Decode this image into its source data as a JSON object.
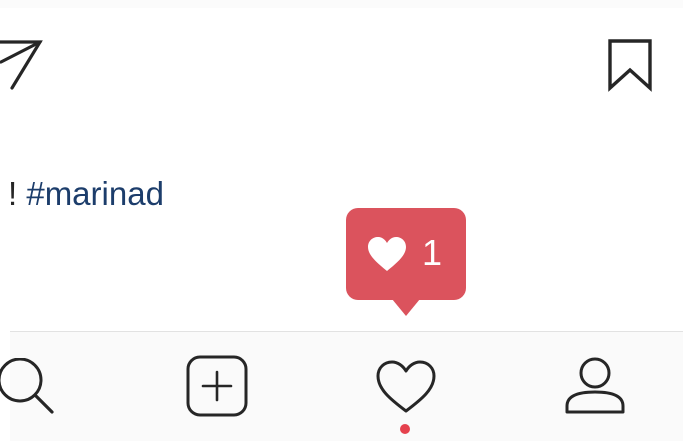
{
  "post": {
    "caption_visible": "! ",
    "hashtag": "#marinad"
  },
  "like_notification": {
    "icon": "heart-icon",
    "count": "1",
    "color": "#db535d"
  },
  "actions": {
    "share_icon": "send-icon",
    "save_icon": "bookmark-icon"
  },
  "tab_bar": {
    "items": [
      {
        "icon": "search-icon",
        "active": false
      },
      {
        "icon": "add-post-icon",
        "active": false
      },
      {
        "icon": "heart-icon",
        "active": false,
        "has_notification": true
      },
      {
        "icon": "profile-icon",
        "active": false
      }
    ],
    "notification_dot_color": "#e5414d"
  }
}
